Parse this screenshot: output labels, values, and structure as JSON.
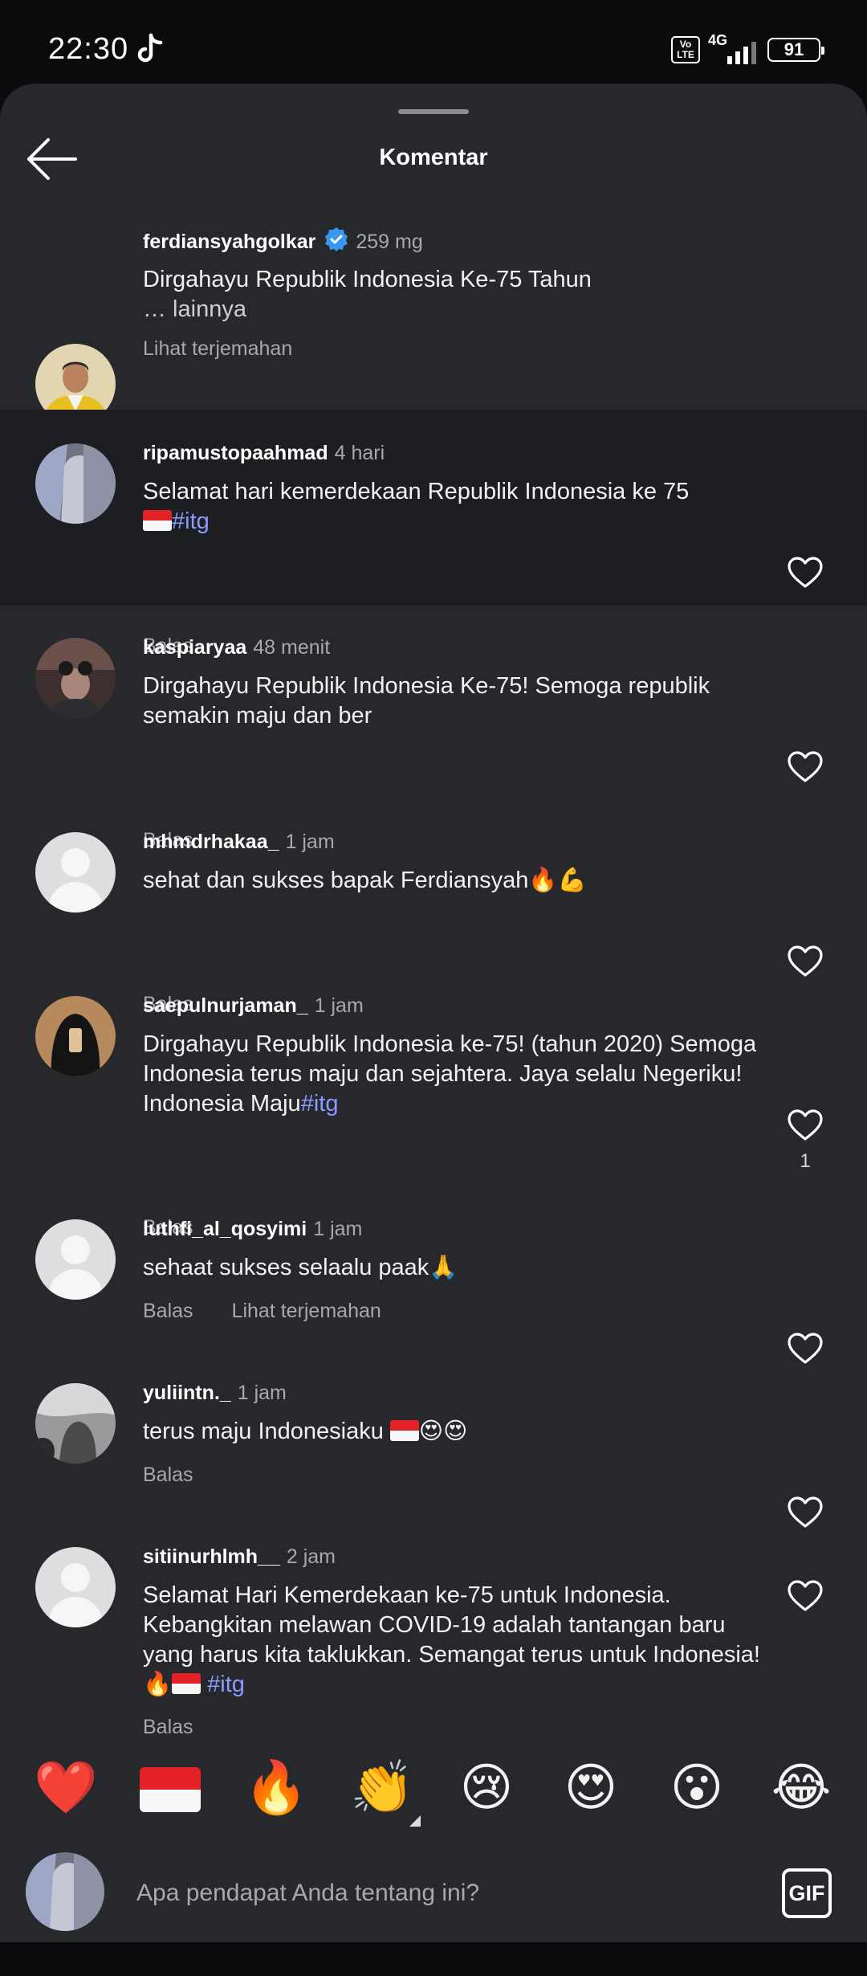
{
  "status_bar": {
    "time": "22:30",
    "volte": "Vo LTE",
    "network": "4G",
    "battery": "91"
  },
  "sheet": {
    "title": "Komentar"
  },
  "caption": {
    "username": "ferdiansyahgolkar",
    "time": "259 mg",
    "text": "Dirgahayu Republik Indonesia Ke-75 Tahun",
    "more": "… lainnya",
    "translate": "Lihat terjemahan"
  },
  "comments": [
    {
      "username": "ripamustopaahmad",
      "time": "4 hari",
      "text": "Selamat hari kemerdekaan Republik Indonesia ke 75",
      "hashtag": "#itg",
      "reply": "Balas"
    },
    {
      "username": "kaspiaryaa",
      "time": "48 menit",
      "text": "Dirgahayu Republik Indonesia Ke-75! Semoga republik semakin maju dan ber",
      "reply": "Balas"
    },
    {
      "username": "mhmdrhakaa_",
      "time": "1 jam",
      "text": "sehat dan sukses bapak Ferdiansyah🔥💪",
      "reply": "Balas"
    },
    {
      "username": "saepulnurjaman_",
      "time": "1 jam",
      "text": "Dirgahayu Republik Indonesia ke-75! (tahun 2020) Semoga Indonesia terus maju dan sejahtera. Jaya selalu Negeriku! Indonesia Maju",
      "hashtag": "#itg",
      "reply": "Balas",
      "likes": "1"
    },
    {
      "username": "luthfi_al_qosyimi",
      "time": "1 jam",
      "text": "sehaat sukses selaalu paak🙏",
      "reply": "Balas",
      "translate": "Lihat terjemahan"
    },
    {
      "username": "yuliintn._",
      "time": "1 jam",
      "text": "terus maju Indonesiaku",
      "text_after_flag": "😍😍",
      "reply": "Balas"
    },
    {
      "username": "sitiinurhlmh__",
      "time": "2 jam",
      "text": "Selamat Hari Kemerdekaan ke-75 untuk Indonesia. Kebangkitan melawan COVID-19 adalah tantangan baru yang harus kita taklukkan. Semangat terus untuk Indonesia!🔥",
      "hashtag": "#itg",
      "reply": "Balas"
    }
  ],
  "reactions": [
    "❤️",
    "flag-indonesia",
    "🔥",
    "👏",
    "😢",
    "😍",
    "😮",
    "😂"
  ],
  "input": {
    "placeholder": "Apa pendapat Anda tentang ini?",
    "gif_label": "GIF"
  },
  "colors": {
    "sheet_bg": "#26282c",
    "highlight_bg": "#1d1e21",
    "hashtag": "#8b9bff",
    "verified": "#3897f0"
  }
}
